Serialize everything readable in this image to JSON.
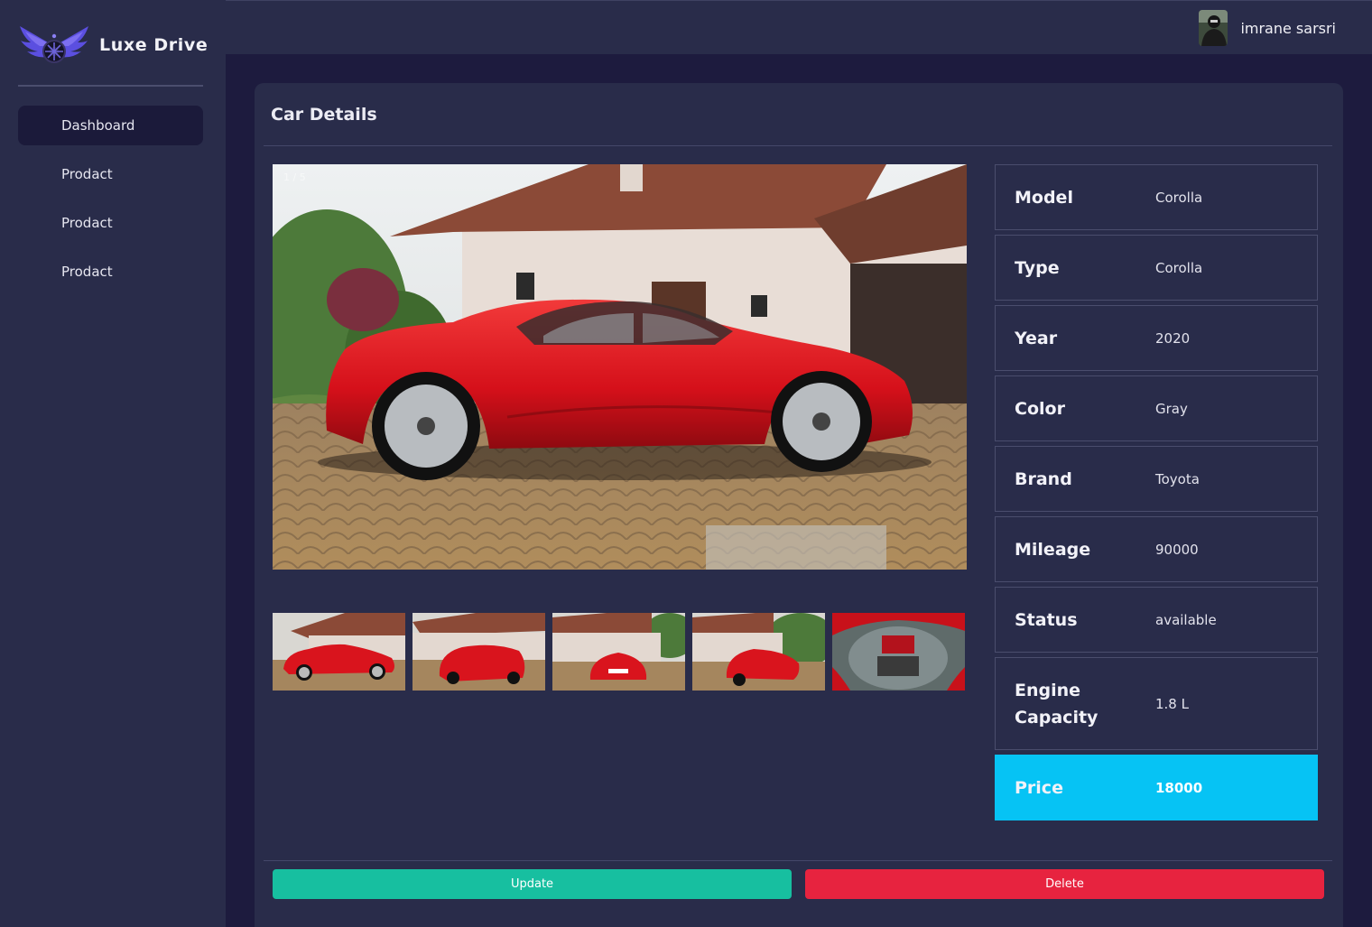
{
  "brand": {
    "name": "Luxe  Drive"
  },
  "sidebar": {
    "items": [
      {
        "label": "Dashboard",
        "active": true
      },
      {
        "label": "Prodact",
        "active": false
      },
      {
        "label": "Prodact",
        "active": false
      },
      {
        "label": "Prodact",
        "active": false
      }
    ]
  },
  "header": {
    "user_name": "imrane sarsri"
  },
  "card": {
    "title": "Car Details",
    "slide_counter": "1 / 5",
    "thumbnail_count": 5
  },
  "specs": [
    {
      "label": "Model",
      "value": "Corolla"
    },
    {
      "label": "Type",
      "value": "Corolla"
    },
    {
      "label": "Year",
      "value": "2020"
    },
    {
      "label": "Color",
      "value": "Gray"
    },
    {
      "label": "Brand",
      "value": "Toyota"
    },
    {
      "label": "Mileage",
      "value": "90000"
    },
    {
      "label": "Status",
      "value": "available"
    },
    {
      "label": "Engine Capacity",
      "value": "1.8 L"
    },
    {
      "label": "Price",
      "value": "18000"
    }
  ],
  "actions": {
    "update_label": "Update",
    "delete_label": "Delete"
  },
  "colors": {
    "background": "#1d1b3e",
    "panel": "#292c4a",
    "accent_price": "#06c3f4",
    "update": "#17bfa0",
    "delete": "#e7233f",
    "car": "#e0111a"
  }
}
